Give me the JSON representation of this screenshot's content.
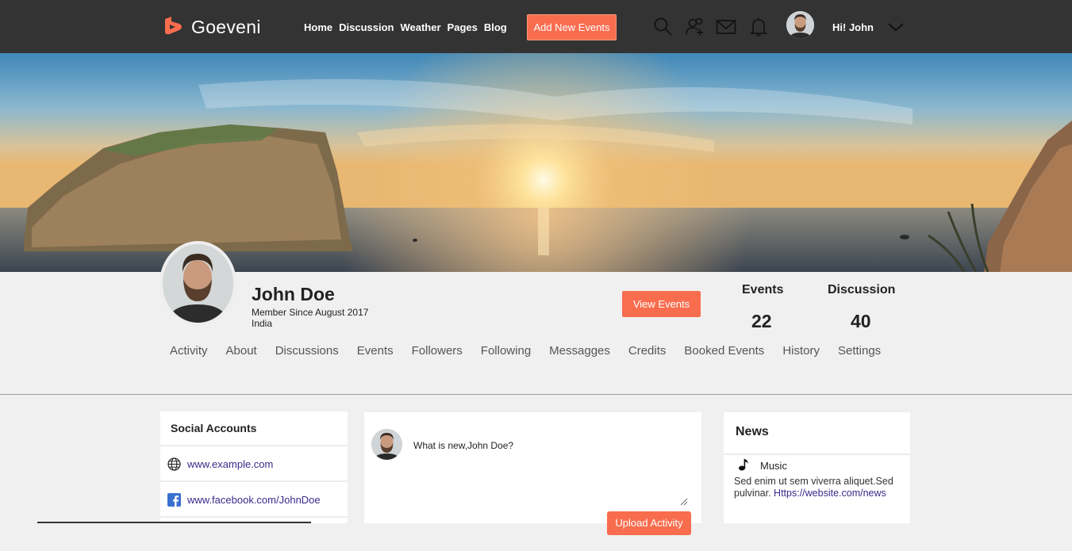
{
  "header": {
    "brand": "Goeveni",
    "nav": [
      "Home",
      "Discussion",
      "Weather",
      "Pages",
      "Blog"
    ],
    "add_button": "Add New Events",
    "icons": [
      "search-icon",
      "add-user-icon",
      "mail-icon",
      "bell-icon"
    ],
    "greeting": "Hi! John"
  },
  "profile": {
    "name": "John Doe",
    "member_since": "Member Since August 2017",
    "country": "India",
    "view_button": "View Events",
    "stats": [
      {
        "label": "Events",
        "value": "22"
      },
      {
        "label": "Discussion",
        "value": "40"
      }
    ],
    "tabs": [
      "Activity",
      "About",
      "Discussions",
      "Events",
      "Followers",
      "Following",
      "Messagges",
      "Credits",
      "Booked Events",
      "History",
      "Settings"
    ]
  },
  "social": {
    "title": "Social Accounts",
    "items": [
      {
        "icon": "globe-icon",
        "text": "www.example.com"
      },
      {
        "icon": "facebook-icon",
        "text": "www.facebook.com/JohnDoe"
      }
    ]
  },
  "post": {
    "placeholder": "What is new,John Doe?",
    "upload_button": "Upload Activity"
  },
  "news": {
    "title": "News",
    "category": "Music",
    "body": "Sed enim ut sem viverra aliquet.Sed pulvinar.",
    "link": "Https://website.com/news"
  },
  "colors": {
    "topbar": "#333333",
    "accent": "#f96d4f",
    "link": "#3a2a8c"
  }
}
